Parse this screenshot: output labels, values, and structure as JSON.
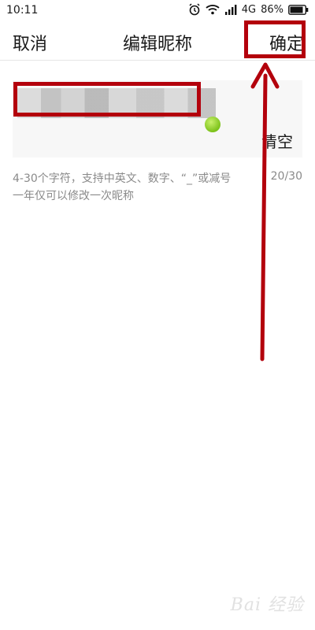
{
  "status_bar": {
    "time": "10:11",
    "network": "4G",
    "battery": "86%"
  },
  "nav": {
    "cancel_label": "取消",
    "title": "编辑昵称",
    "confirm_label": "确定"
  },
  "name_field": {
    "clear_label": "清空",
    "counter": "20/30"
  },
  "hint": {
    "line1": "4-30个字符，支持中英文、数字、“_”或减号",
    "line2": "一年仅可以修改一次昵称"
  },
  "watermark": "Bai 经验",
  "colors": {
    "annotation_red": "#b3000c",
    "caret_green": "#7cc21a"
  }
}
